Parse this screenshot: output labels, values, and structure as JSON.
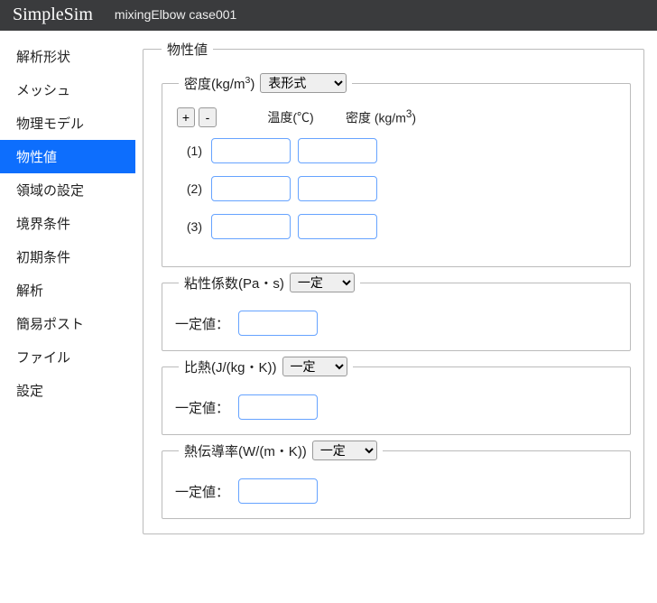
{
  "topbar": {
    "brand": "SimpleSim",
    "subtitle": "mixingElbow case001"
  },
  "sidebar": {
    "items": [
      {
        "label": "解析形状"
      },
      {
        "label": "メッシュ"
      },
      {
        "label": "物理モデル"
      },
      {
        "label": "物性値"
      },
      {
        "label": "領域の設定"
      },
      {
        "label": "境界条件"
      },
      {
        "label": "初期条件"
      },
      {
        "label": "解析"
      },
      {
        "label": "簡易ポスト"
      },
      {
        "label": "ファイル"
      },
      {
        "label": "設定"
      }
    ],
    "active_index": 3
  },
  "panel": {
    "outer_legend": "物性値",
    "density": {
      "legend_prefix": "密度(kg/m",
      "legend_supnum": "3",
      "legend_suffix": ")",
      "mode_options": [
        "表形式",
        "一定"
      ],
      "mode_selected": "表形式",
      "btn_plus": "+",
      "btn_minus": "-",
      "col1_label": "温度(℃)",
      "col2_prefix": "密度 (kg/m",
      "col2_supnum": "3",
      "col2_suffix": ")",
      "rows": [
        {
          "num": "(1)",
          "temp": "",
          "val": ""
        },
        {
          "num": "(2)",
          "temp": "",
          "val": ""
        },
        {
          "num": "(3)",
          "temp": "",
          "val": ""
        }
      ]
    },
    "viscosity": {
      "legend": "粘性係数(Pa・s)",
      "mode_options": [
        "一定",
        "表形式"
      ],
      "mode_selected": "一定",
      "const_label": "一定値："
    },
    "specific_heat": {
      "legend": "比熱(J/(kg・K))",
      "mode_options": [
        "一定",
        "表形式"
      ],
      "mode_selected": "一定",
      "const_label": "一定値："
    },
    "thermal_cond": {
      "legend": "熱伝導率(W/(m・K))",
      "mode_options": [
        "一定",
        "表形式"
      ],
      "mode_selected": "一定",
      "const_label": "一定値："
    }
  }
}
